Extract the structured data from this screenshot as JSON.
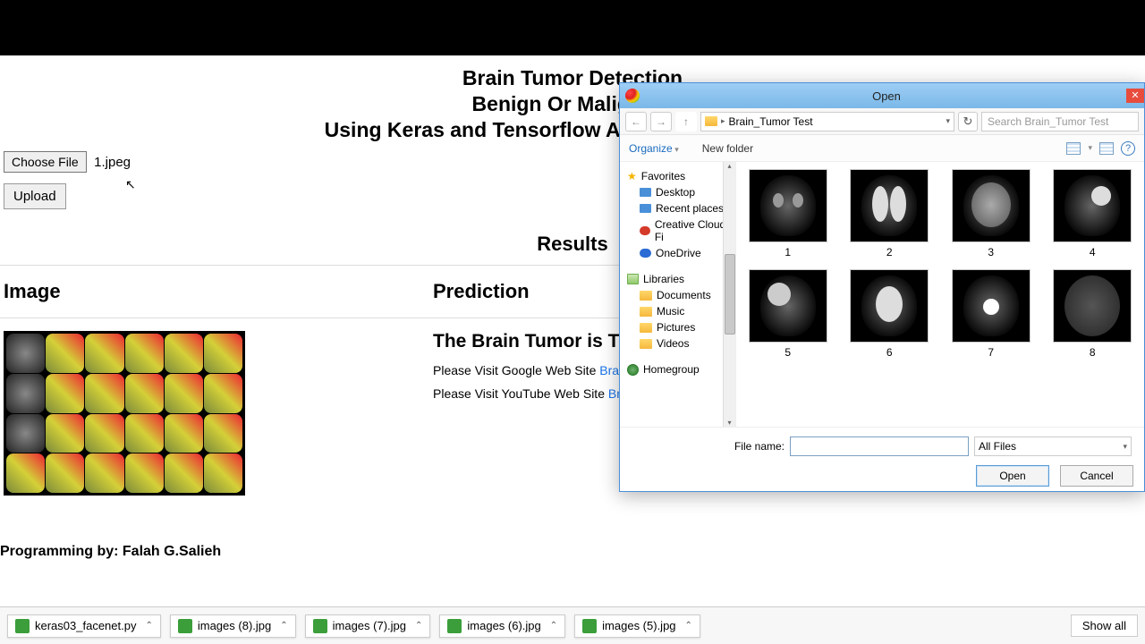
{
  "header": {
    "title1": "Brain Tumor Detection",
    "title2": "Benign Or Malignant",
    "title3": "Using Keras and Tensorflow API Deep Learning By"
  },
  "upload": {
    "choose_label": "Choose File",
    "selected_file": "1.jpeg",
    "upload_label": "Upload"
  },
  "results": {
    "heading": "Results",
    "col_image": "Image",
    "col_prediction": "Prediction",
    "pred_heading": "The Brain Tumor is The",
    "link1_prefix": "Please Visit Google Web Site ",
    "link1_text": "Brain Tu",
    "link2_prefix": "Please Visit YouTube Web Site ",
    "link2_text": "Brain "
  },
  "author": "Programming by: Falah G.Salieh",
  "downloads": {
    "items": [
      "keras03_facenet.py",
      "images (8).jpg",
      "images (7).jpg",
      "images (6).jpg",
      "images (5).jpg"
    ],
    "show_all": "Show all"
  },
  "dialog": {
    "title": "Open",
    "path": "Brain_Tumor Test",
    "search_placeholder": "Search Brain_Tumor Test",
    "organize": "Organize",
    "new_folder": "New folder",
    "sidebar": {
      "favorites": "Favorites",
      "fav_items": [
        "Desktop",
        "Recent places",
        "Creative Cloud Fi",
        "OneDrive"
      ],
      "libraries": "Libraries",
      "lib_items": [
        "Documents",
        "Music",
        "Pictures",
        "Videos"
      ],
      "homegroup": "Homegroup"
    },
    "files": [
      "1",
      "2",
      "3",
      "4",
      "5",
      "6",
      "7",
      "8"
    ],
    "file_name_label": "File name:",
    "file_name_value": "",
    "type_filter": "All Files",
    "open_btn": "Open",
    "cancel_btn": "Cancel"
  }
}
